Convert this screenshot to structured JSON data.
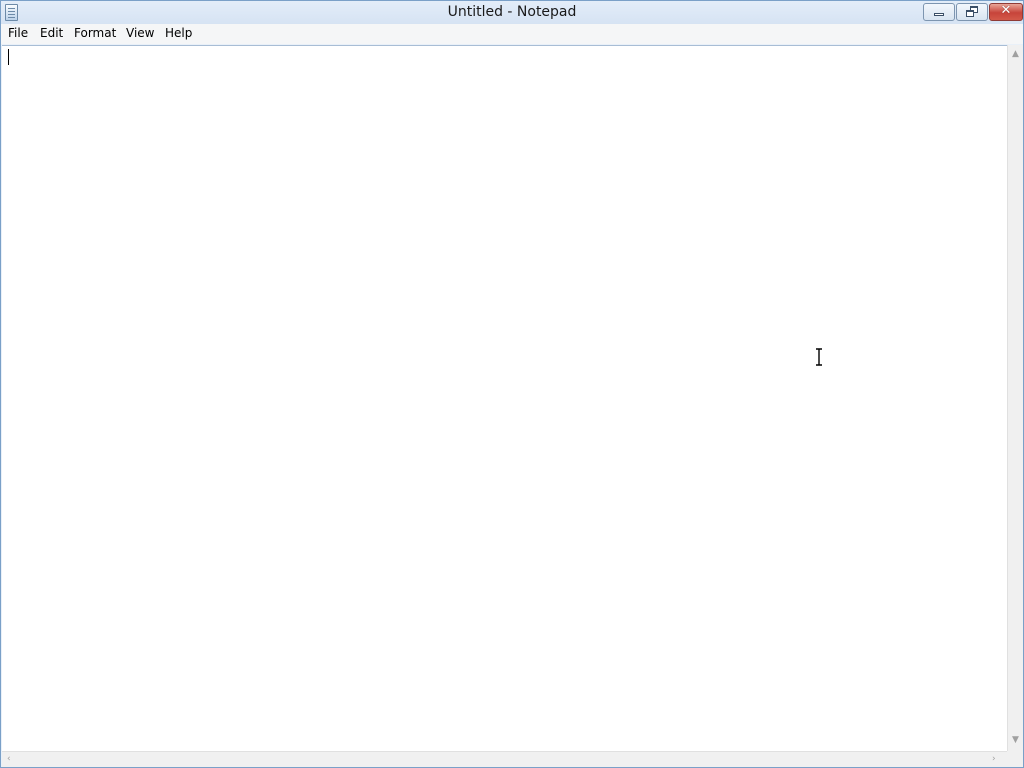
{
  "window": {
    "title": "Untitled - Notepad",
    "minimize_icon": "minimize-icon",
    "maximize_icon": "restore-icon",
    "close_icon": "close-icon",
    "close_glyph": "✕"
  },
  "menubar": {
    "items": [
      {
        "label": "File"
      },
      {
        "label": "Edit"
      },
      {
        "label": "Format"
      },
      {
        "label": "View"
      },
      {
        "label": "Help"
      }
    ]
  },
  "editor": {
    "content": ""
  },
  "scrollbars": {
    "up_arrow": "▲",
    "down_arrow": "▼",
    "left_arrow": "‹",
    "right_arrow": "›"
  },
  "colors": {
    "title_bar": "#dbe7f5",
    "close_button": "#c7443a",
    "editor_background": "#ffffff"
  }
}
